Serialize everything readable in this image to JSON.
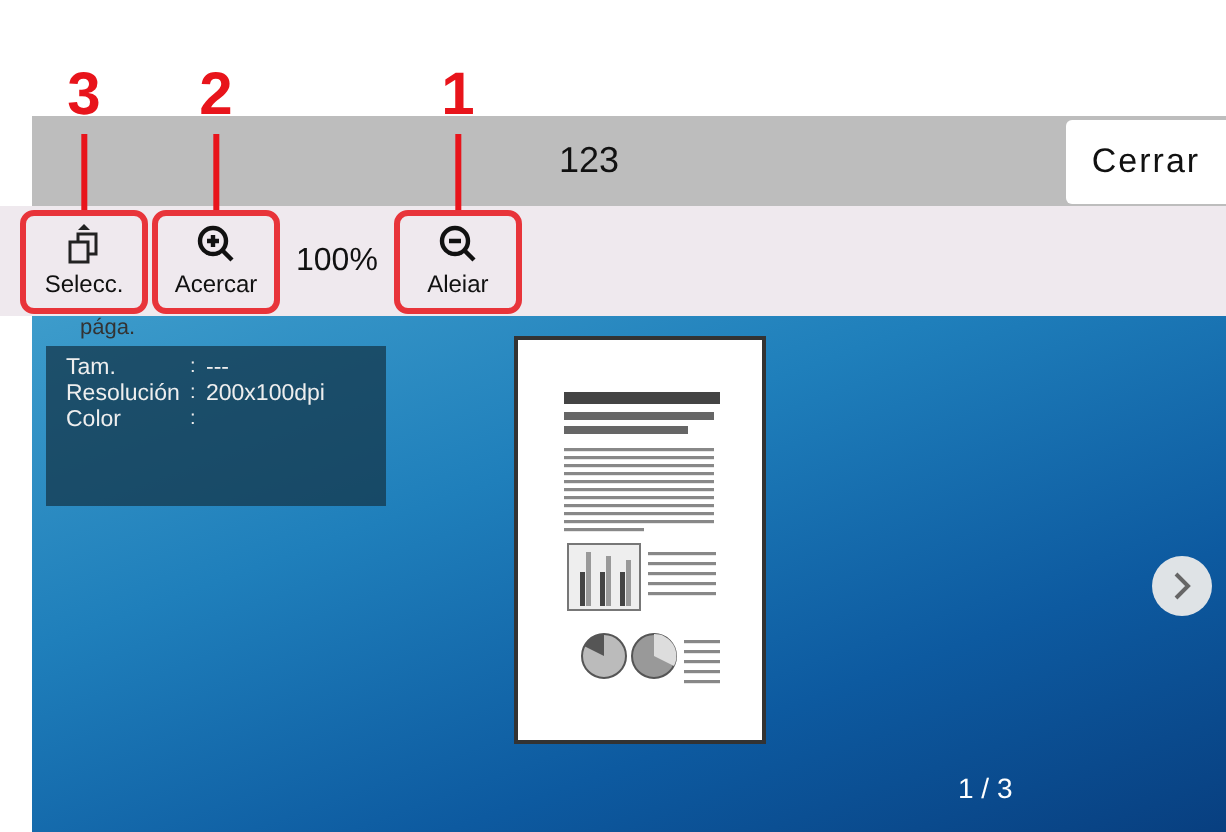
{
  "header": {
    "title": "123",
    "close_button": "Cerrar"
  },
  "toolbar": {
    "buttons": [
      {
        "kind": "select",
        "label": "Selecc.",
        "callout": "3",
        "highlighted": true
      },
      {
        "kind": "zoom_in",
        "label": "Acercar",
        "callout": "2",
        "highlighted": true
      },
      {
        "kind": "zoom_level",
        "label": "100%"
      },
      {
        "kind": "zoom_out",
        "label": "Aleiar",
        "callout": "1",
        "highlighted": true
      }
    ]
  },
  "preview": {
    "cut_text": "pága.",
    "info": [
      {
        "label": "Tam.",
        "separator": ":",
        "value": "---"
      },
      {
        "label": "Resolución",
        "separator": ":",
        "value": "200x100dpi"
      },
      {
        "label": "Color",
        "separator": ":"
      }
    ],
    "page_counter": "1 / 3"
  }
}
